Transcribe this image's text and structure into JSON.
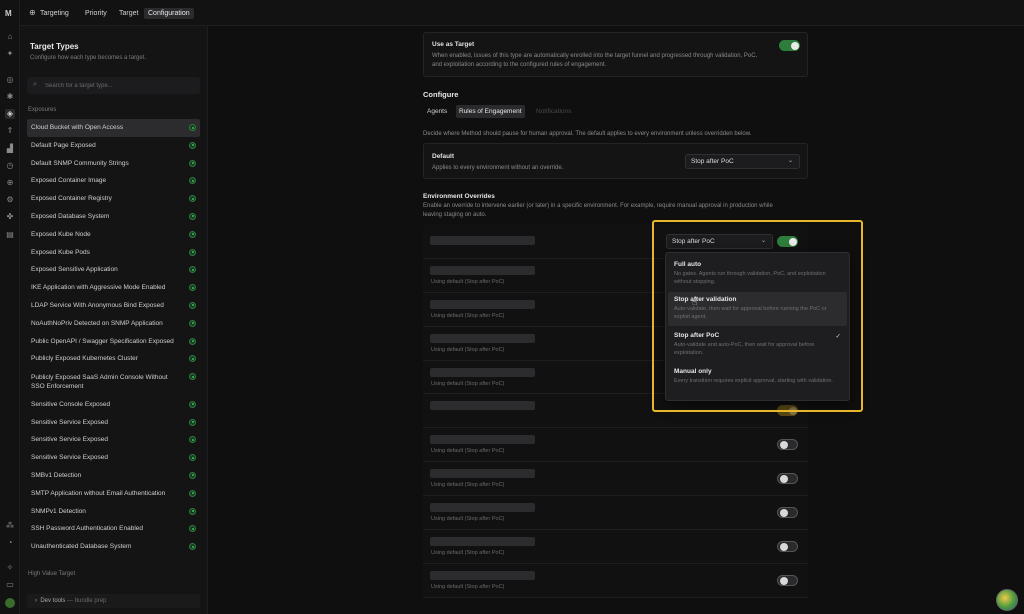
{
  "topbar": {
    "crumbs": [
      "Targeting",
      "Priority",
      "Target",
      "Configuration"
    ]
  },
  "rail_icons": [
    "home-icon",
    "navigate-icon",
    "targeting-icon",
    "bug-icon",
    "config-icon",
    "rocket-icon",
    "chart-icon",
    "clock-icon",
    "globe-icon",
    "settings-icon",
    "puzzle-icon",
    "document-icon",
    "grid-icon",
    "history-icon",
    "spark-icon",
    "book-icon",
    "avatar-icon"
  ],
  "left": {
    "title": "Target Types",
    "subtitle": "Configure how each type becomes a target.",
    "search_placeholder": "Search for a target type...",
    "section_exposures": "Exposures",
    "section_hvt": "High Value Target",
    "items": [
      "Cloud Bucket with Open Access",
      "Default Page Exposed",
      "Default SNMP Community Strings",
      "Exposed Container Image",
      "Exposed Container Registry",
      "Exposed Database System",
      "Exposed Kube Node",
      "Exposed Kube Pods",
      "Exposed Sensitive Application",
      "IKE Application with Aggressive Mode Enabled",
      "LDAP Service With Anonymous Bind Exposed",
      "NoAuthNoPriv Detected on SNMP Application",
      "Public OpenAPI / Swagger Specification Exposed",
      "Publicly Exposed Kubernetes Cluster",
      "Publicly Exposed SaaS Admin Console Without SSO Enforcement",
      "Sensitive Console Exposed",
      "Sensitive Service Exposed",
      "Sensitive Service Exposed",
      "Sensitive Service Exposed",
      "SMBv1 Detection",
      "SMTP Application without Email Authentication",
      "SNMPv1 Detection",
      "SSH Password Authentication Enabled",
      "Unauthenticated Database System"
    ],
    "devtools_label": "Dev tools",
    "devtools_sub": "— bundle prep"
  },
  "main": {
    "use_as_target": {
      "title": "Use as Target",
      "text": "When enabled, issues of this type are automatically enrolled into the target funnel and progressed through validation, PoC, and exploitation according to the configured rules of engagement.",
      "enabled": true
    },
    "configure_heading": "Configure",
    "tabs": [
      "Agents",
      "Rules of Engagement",
      "Notifications"
    ],
    "description": "Decide where Method should pause for human approval. The default applies to every environment unless overridden below.",
    "default_card": {
      "title": "Default",
      "text": "Applies to every environment without an override.",
      "value": "Stop after PoC"
    },
    "env_heading": "Environment Overrides",
    "env_text": "Enable an override to intervene earlier (or later) in a specific environment. For example, require manual approval in production while leaving staging on auto.",
    "first_row_select": "Stop after PoC",
    "row_default_text": "Using default (Stop after PoC)",
    "dropdown": [
      {
        "label": "Full auto",
        "desc": "No gates. Agents run through validation, PoC, and exploitation without stopping."
      },
      {
        "label": "Stop after validation",
        "desc": "Auto-validate, then wait for approval before running the PoC or exploit agent."
      },
      {
        "label": "Stop after PoC",
        "desc": "Auto-validate and auto-PoC, then wait for approval before exploitation.",
        "selected": true
      },
      {
        "label": "Manual only",
        "desc": "Every transition requires explicit approval, starting with validation."
      }
    ]
  }
}
